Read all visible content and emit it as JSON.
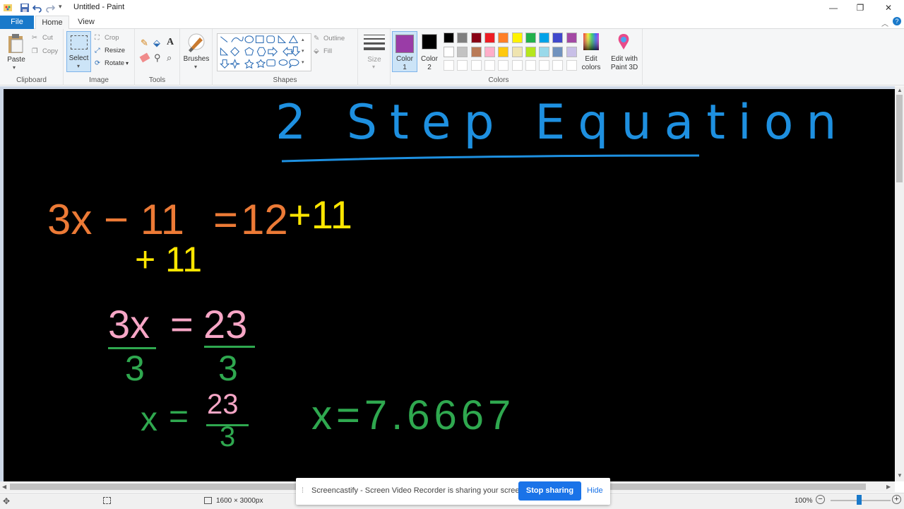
{
  "window": {
    "title": "Untitled - Paint",
    "minimize": "—",
    "maximize": "❐",
    "close": "✕"
  },
  "menu": {
    "file": "File",
    "home": "Home",
    "view": "View"
  },
  "ribbon": {
    "clipboard": {
      "label": "Clipboard",
      "paste": "Paste",
      "cut": "Cut",
      "copy": "Copy"
    },
    "image": {
      "label": "Image",
      "select": "Select",
      "crop": "Crop",
      "resize": "Resize",
      "rotate": "Rotate"
    },
    "tools": {
      "label": "Tools"
    },
    "brushes": {
      "label": "Brushes"
    },
    "shapes": {
      "label": "Shapes",
      "outline": "Outline",
      "fill": "Fill"
    },
    "size": {
      "label": "Size"
    },
    "colors": {
      "label": "Colors",
      "color1": "Color\n1",
      "color2": "Color\n2",
      "color1_value": "#9a3ca7",
      "color2_value": "#000000",
      "edit_colors": "Edit\ncolors",
      "edit_paint3d": "Edit with\nPaint 3D",
      "palette_row1": [
        "#000000",
        "#7f7f7f",
        "#880015",
        "#ed1c24",
        "#ff7f27",
        "#fff200",
        "#22b14c",
        "#00a2e8",
        "#3f48cc",
        "#a349a4"
      ],
      "palette_row2": [
        "#ffffff",
        "#c3c3c3",
        "#b97a57",
        "#ffaec9",
        "#ffc90e",
        "#efe4b0",
        "#b5e61d",
        "#99d9ea",
        "#7092be",
        "#c8bfe7"
      ]
    }
  },
  "canvas": {
    "title": "2 Step Equation",
    "title_color": "#1e90e0",
    "line1_left": "3x − 11",
    "line1_eq": "=",
    "line1_right": "12",
    "line1_add_right": "+11",
    "line2_add_left": "+ 11",
    "line3_left": "3x",
    "line3_eq": "=",
    "line3_right": "23",
    "line3_den_left": "3",
    "line3_den_right": "3",
    "line4_left": "x",
    "line4_eq": "=",
    "line4_num": "23",
    "line4_den": "3",
    "result": "x=7.6667",
    "orange": "#ec7a36",
    "yellow": "#ffe600",
    "pink": "#f7a6c6",
    "green": "#2fa84f"
  },
  "status": {
    "canvas_size": "1600 × 3000px",
    "zoom": "100%"
  },
  "share": {
    "text": "Screencastify - Screen Video Recorder is sharing your screen.",
    "stop": "Stop sharing",
    "hide": "Hide"
  }
}
